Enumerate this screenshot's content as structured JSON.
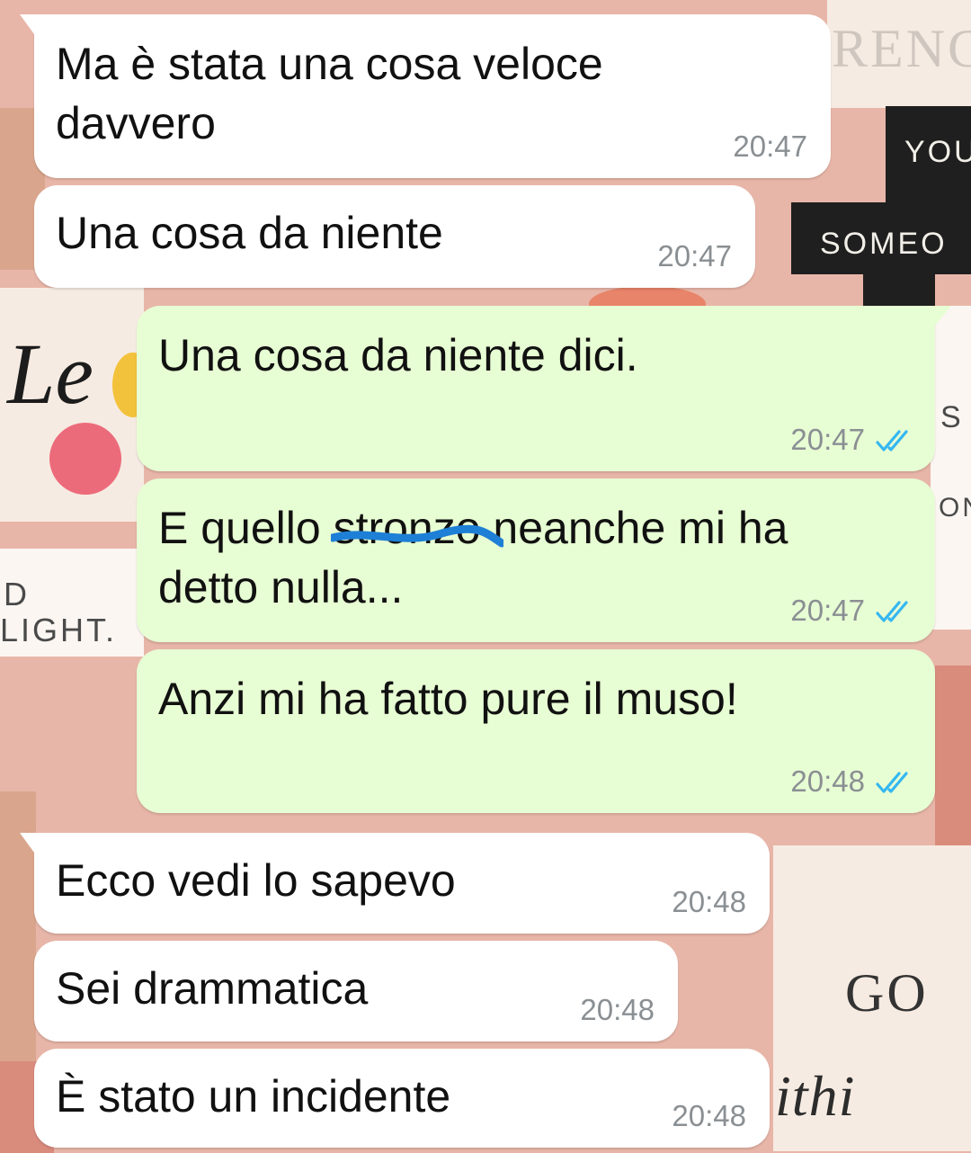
{
  "colors": {
    "incoming_bubble": "#ffffff",
    "outgoing_bubble": "#e7fdd3",
    "timestamp": "#8a8f93",
    "read_ticks": "#34b7f1",
    "scribble": "#1e7fd6"
  },
  "wallpaper": {
    "fragments": [
      "RENG",
      "YOU",
      "SOMEO",
      "S",
      "ON",
      "D",
      "LIGHT.",
      "GO",
      "ithi",
      "Le"
    ]
  },
  "messages": [
    {
      "id": "m1",
      "direction": "incoming",
      "lines": [
        "Ma è stata una cosa veloce",
        "davvero"
      ],
      "time": "20:47"
    },
    {
      "id": "m2",
      "direction": "incoming",
      "lines": [
        "Una cosa da niente"
      ],
      "time": "20:47"
    },
    {
      "id": "m3",
      "direction": "outgoing",
      "lines": [
        "Una cosa da niente dici."
      ],
      "time": "20:47",
      "status_icon": "double-check-read-icon"
    },
    {
      "id": "m4",
      "direction": "outgoing",
      "lines": [
        "E quello stronzo neanche mi ha",
        "detto nulla..."
      ],
      "time": "20:47",
      "status_icon": "double-check-read-icon",
      "redacted_word": "stronzo"
    },
    {
      "id": "m5",
      "direction": "outgoing",
      "lines": [
        "Anzi mi ha fatto pure il muso!"
      ],
      "time": "20:48",
      "status_icon": "double-check-read-icon"
    },
    {
      "id": "m6",
      "direction": "incoming",
      "lines": [
        "Ecco vedi lo sapevo"
      ],
      "time": "20:48"
    },
    {
      "id": "m7",
      "direction": "incoming",
      "lines": [
        "Sei drammatica"
      ],
      "time": "20:48"
    },
    {
      "id": "m8",
      "direction": "incoming",
      "lines": [
        "È stato un incidente"
      ],
      "time": "20:48"
    }
  ]
}
